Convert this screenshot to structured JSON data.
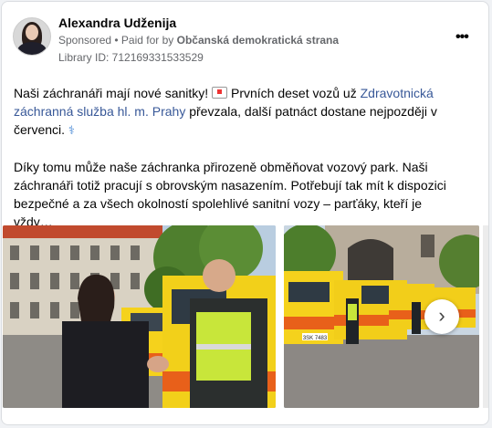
{
  "post": {
    "author": "Alexandra Udženija",
    "sponsored": "Sponsored",
    "paid_prefix": "• Paid for by",
    "paid_by": "Občanská demokratická strana",
    "library_id": "Library ID: 712169331533529",
    "more_label": "•••",
    "text_line1_a": "Naši záchranáři mají nové sanitky!",
    "text_line1_b": "Prvních deset vozů už",
    "link_text": "Zdravotnická záchranná služba hl. m. Prahy",
    "text_line1_c": "převzala, další patnáct dostane nejpozději v červenci.",
    "text_para2": "Díky tomu může naše záchranka přirozeně obměňovat vozový park. Naši záchranáři totiž pracují s obrovským nasazením. Potřebují tak mít k dispozici bezpečné a za všech okolností spolehlivé sanitní vozy – parťáky, kteří je vždy…",
    "next_arrow": "›",
    "plate": "3SK 7483"
  },
  "colors": {
    "link": "#385898",
    "ambulance_yellow": "#f5d21c",
    "ambulance_orange": "#e8601a"
  }
}
